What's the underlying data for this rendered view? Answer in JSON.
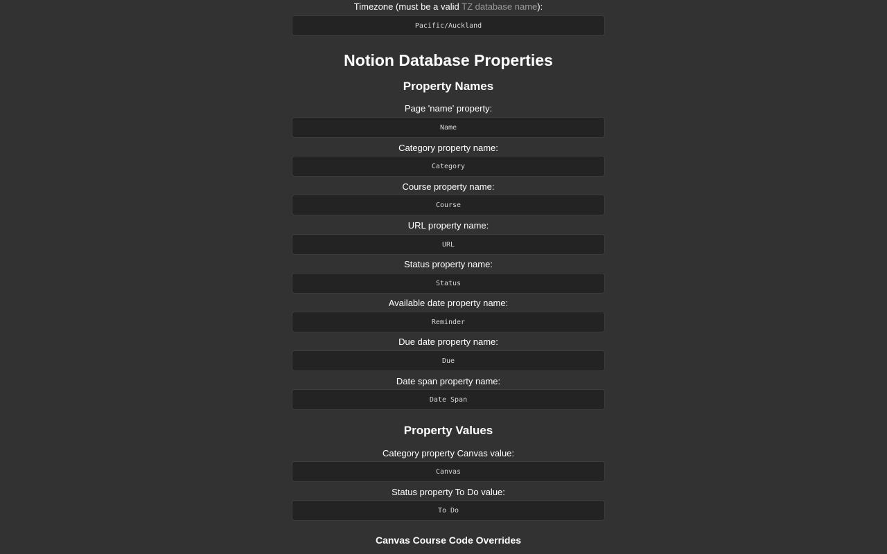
{
  "timezone": {
    "label_prefix": "Timezone (must be a valid ",
    "label_link": "TZ database name",
    "label_suffix": "):",
    "value": "Pacific/Auckland"
  },
  "notion": {
    "title": "Notion Database Properties",
    "names_heading": "Property Names",
    "fields": [
      {
        "label": "Page 'name' property:",
        "value": "Name"
      },
      {
        "label": "Category property name:",
        "value": "Category"
      },
      {
        "label": "Course property name:",
        "value": "Course"
      },
      {
        "label": "URL property name:",
        "value": "URL"
      },
      {
        "label": "Status property name:",
        "value": "Status"
      },
      {
        "label": "Available date property name:",
        "value": "Reminder"
      },
      {
        "label": "Due date property name:",
        "value": "Due"
      },
      {
        "label": "Date span property name:",
        "value": "Date Span"
      }
    ],
    "values_heading": "Property Values",
    "value_fields": [
      {
        "label": "Category property Canvas value:",
        "value": "Canvas"
      },
      {
        "label": "Status property To Do value:",
        "value": "To Do"
      }
    ]
  },
  "overrides": {
    "heading": "Canvas Course Code Overrides"
  }
}
